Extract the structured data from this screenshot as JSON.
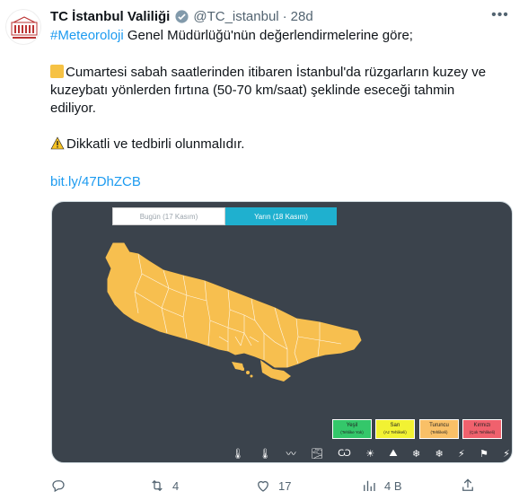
{
  "tweet": {
    "author_name": "TC İstanbul Valiliği",
    "handle": "@TC_istanbul",
    "separator": "·",
    "time": "28d",
    "hashtag": "#Meteoroloji",
    "line1_rest": " Genel Müdürlüğü'nün değerlendirmelerine göre;",
    "para2_line1": "Cumartesi sabah saatlerinden itibaren İstanbul'da rüzgarların kuzey ve",
    "para2_line2": "kuzeybatı yönlerden fırtına (50-70 km/saat) şeklinde eseceği tahmin",
    "para2_line3": "ediliyor.",
    "warning_text": "Dikkatli ve tedbirli olunmalıdır.",
    "link": "bit.ly/47DhZCB"
  },
  "media": {
    "tab_today": "Bugün (17 Kasım)",
    "tab_tomorrow": "Yarın (18 Kasım)",
    "legend": [
      {
        "label": "Yeşil",
        "sub": "(Tehlike Yok)",
        "color": "#34c76a"
      },
      {
        "label": "Sarı",
        "sub": "(Az Tehlikeli)",
        "color": "#f2f233"
      },
      {
        "label": "Turuncu",
        "sub": "(Tehlikeli)",
        "color": "#f9c067"
      },
      {
        "label": "Kırmızı",
        "sub": "(Çok Tehlikeli)",
        "color": "#f0616d"
      }
    ],
    "weather_icons": [
      "🌡",
      "🌡",
      "〰",
      "🌫",
      "Ѡ",
      "☀",
      "⛰",
      "❄",
      "❄",
      "⚡",
      "⚑",
      "⚡"
    ]
  },
  "actions": {
    "replies": "",
    "retweets": "4",
    "likes": "17",
    "views": "4 B"
  },
  "colors": {
    "accent": "#1d9bf0",
    "map_yellow": "#f7bf4f",
    "map_bg": "#3b434c",
    "active_tab": "#1fb0cf"
  }
}
